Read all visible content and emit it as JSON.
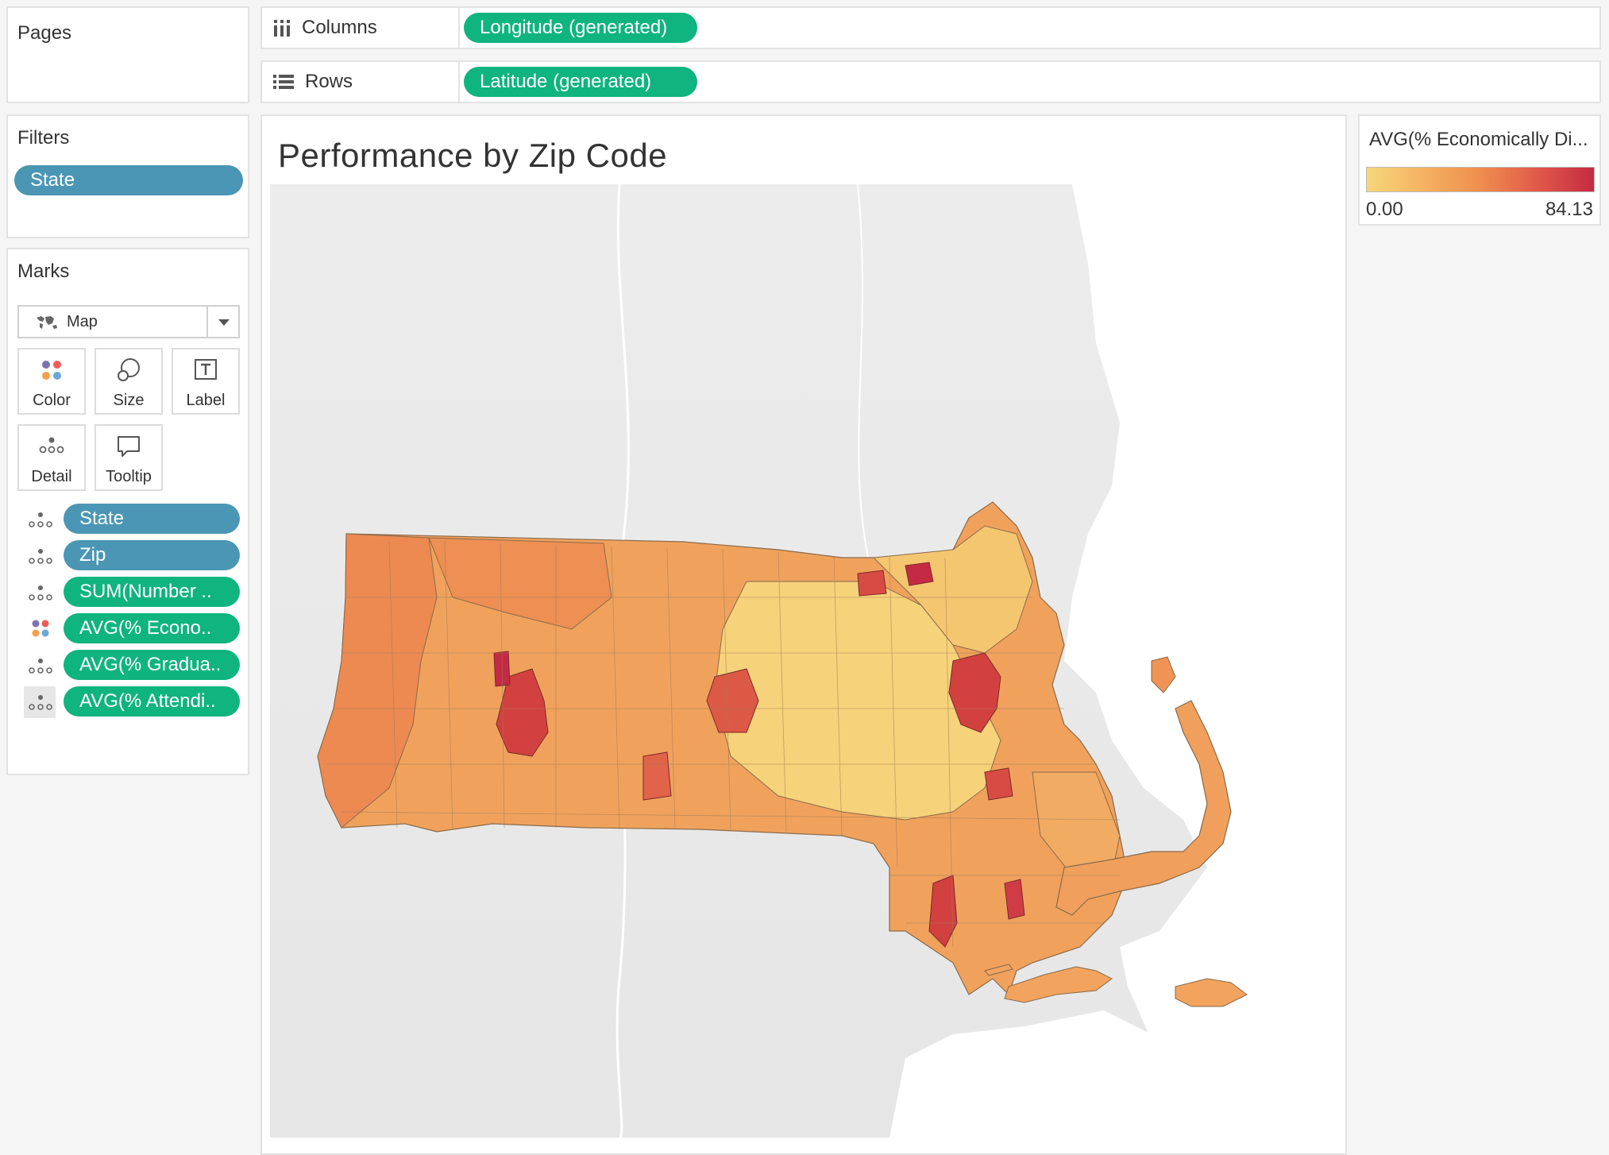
{
  "shelves": {
    "pages_label": "Pages",
    "columns_label": "Columns",
    "rows_label": "Rows",
    "columns_pill": "Longitude (generated)",
    "rows_pill": "Latitude (generated)"
  },
  "filters": {
    "title": "Filters",
    "items": [
      "State"
    ]
  },
  "marks": {
    "title": "Marks",
    "mark_type": "Map",
    "buttons": {
      "color": "Color",
      "size": "Size",
      "label": "Label",
      "detail": "Detail",
      "tooltip": "Tooltip"
    },
    "fields": [
      {
        "label": "State",
        "kind": "blue",
        "icon": "detail-icon"
      },
      {
        "label": "Zip",
        "kind": "blue",
        "icon": "detail-icon"
      },
      {
        "label": "SUM(Number ..",
        "kind": "green",
        "icon": "detail-icon"
      },
      {
        "label": "AVG(% Econo..",
        "kind": "green",
        "icon": "color-icon"
      },
      {
        "label": "AVG(% Gradua..",
        "kind": "green",
        "icon": "detail-icon"
      },
      {
        "label": "AVG(% Attendi..",
        "kind": "green",
        "icon": "detail-icon"
      }
    ]
  },
  "viz": {
    "title": "Performance by Zip Code"
  },
  "legend": {
    "title": "AVG(% Economically Di...",
    "min": "0.00",
    "max": "84.13",
    "color_low": "#f6d77a",
    "color_mid": "#ef8e4e",
    "color_high": "#c42a43"
  },
  "colors": {
    "pill_blue": "#4a96b4",
    "pill_green": "#0fb47e"
  }
}
